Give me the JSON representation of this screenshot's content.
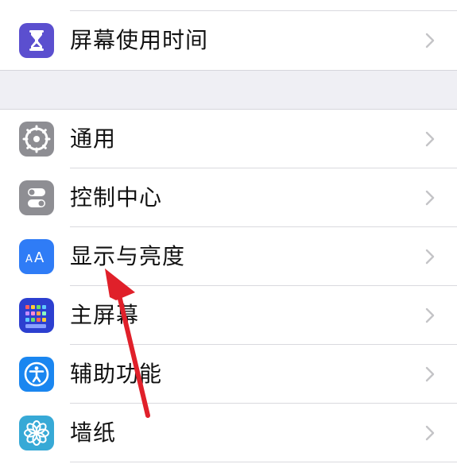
{
  "settings": {
    "group1": [
      {
        "label": "屏幕使用时间",
        "icon": "hourglass-icon",
        "color": "#5b4fcf"
      }
    ],
    "group2": [
      {
        "label": "通用",
        "icon": "gear-icon",
        "color": "#8e8e93"
      },
      {
        "label": "控制中心",
        "icon": "toggles-icon",
        "color": "#8e8e93"
      },
      {
        "label": "显示与亮度",
        "icon": "text-size-icon",
        "color": "#2f7cf6"
      },
      {
        "label": "主屏幕",
        "icon": "home-grid-icon",
        "color": "#2c3fd0"
      },
      {
        "label": "辅助功能",
        "icon": "accessibility-icon",
        "color": "#1a86f0"
      },
      {
        "label": "墙纸",
        "icon": "flower-icon",
        "color": "#37a9d6"
      }
    ]
  },
  "annotation": {
    "arrow_color": "#e0202a",
    "target": "显示与亮度"
  }
}
